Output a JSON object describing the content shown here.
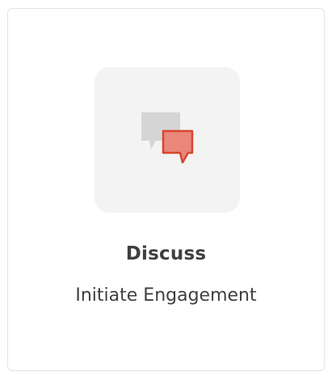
{
  "card": {
    "title": "Discuss",
    "subtitle": "Initiate Engagement",
    "icon": "chat-bubbles-icon"
  },
  "colors": {
    "tile_background": "#f3f3f3",
    "back_bubble": "#d5d5d5",
    "front_bubble_fill": "#e8877a",
    "front_bubble_stroke": "#d9452f",
    "text": "#3f3f3f"
  }
}
